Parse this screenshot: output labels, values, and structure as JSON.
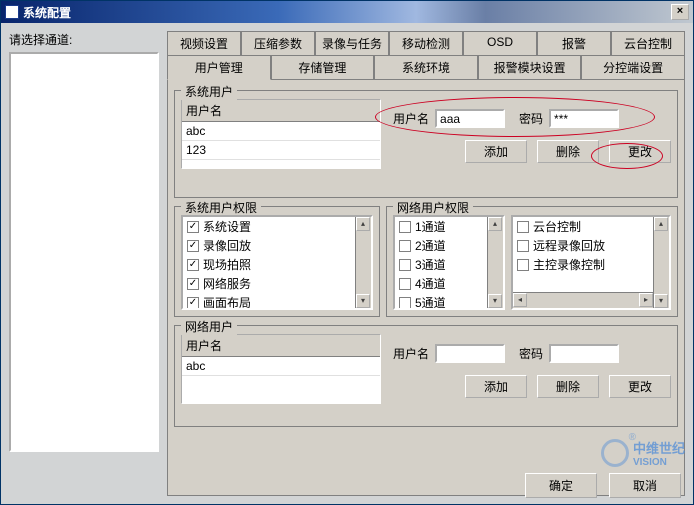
{
  "window": {
    "title": "系统配置"
  },
  "left": {
    "label": "请选择通道:"
  },
  "tabs_row1": [
    "视频设置",
    "压缩参数",
    "录像与任务",
    "移动检测",
    "OSD",
    "报警",
    "云台控制"
  ],
  "tabs_row2": [
    "用户管理",
    "存储管理",
    "系统环境",
    "报警模块设置",
    "分控端设置"
  ],
  "active_tab": "用户管理",
  "sysuser": {
    "group": "系统用户",
    "col": "用户名",
    "rows": [
      "abc",
      "123"
    ],
    "un_label": "用户名",
    "un_value": "aaa",
    "pw_label": "密码",
    "pw_value": "***",
    "btn_add": "添加",
    "btn_del": "删除",
    "btn_mod": "更改"
  },
  "sysperm": {
    "group": "系统用户权限",
    "items": [
      {
        "label": "系统设置",
        "checked": true
      },
      {
        "label": "录像回放",
        "checked": true
      },
      {
        "label": "现场拍照",
        "checked": true
      },
      {
        "label": "网络服务",
        "checked": true
      },
      {
        "label": "画面布局",
        "checked": true
      }
    ]
  },
  "netperm": {
    "group": "网络用户权限",
    "channels": [
      {
        "label": "1通道",
        "checked": false
      },
      {
        "label": "2通道",
        "checked": false
      },
      {
        "label": "3通道",
        "checked": false
      },
      {
        "label": "4通道",
        "checked": false
      },
      {
        "label": "5通道",
        "checked": false
      }
    ],
    "controls": [
      {
        "label": "云台控制",
        "checked": false
      },
      {
        "label": "远程录像回放",
        "checked": false
      },
      {
        "label": "主控录像控制",
        "checked": false
      }
    ]
  },
  "netuser": {
    "group": "网络用户",
    "col": "用户名",
    "rows": [
      "abc"
    ],
    "un_label": "用户名",
    "pw_label": "密码",
    "btn_add": "添加",
    "btn_del": "删除",
    "btn_mod": "更改"
  },
  "footer": {
    "ok": "确定",
    "cancel": "取消"
  },
  "watermark": {
    "brand_cn": "中维世纪",
    "brand_en": "VISION"
  }
}
